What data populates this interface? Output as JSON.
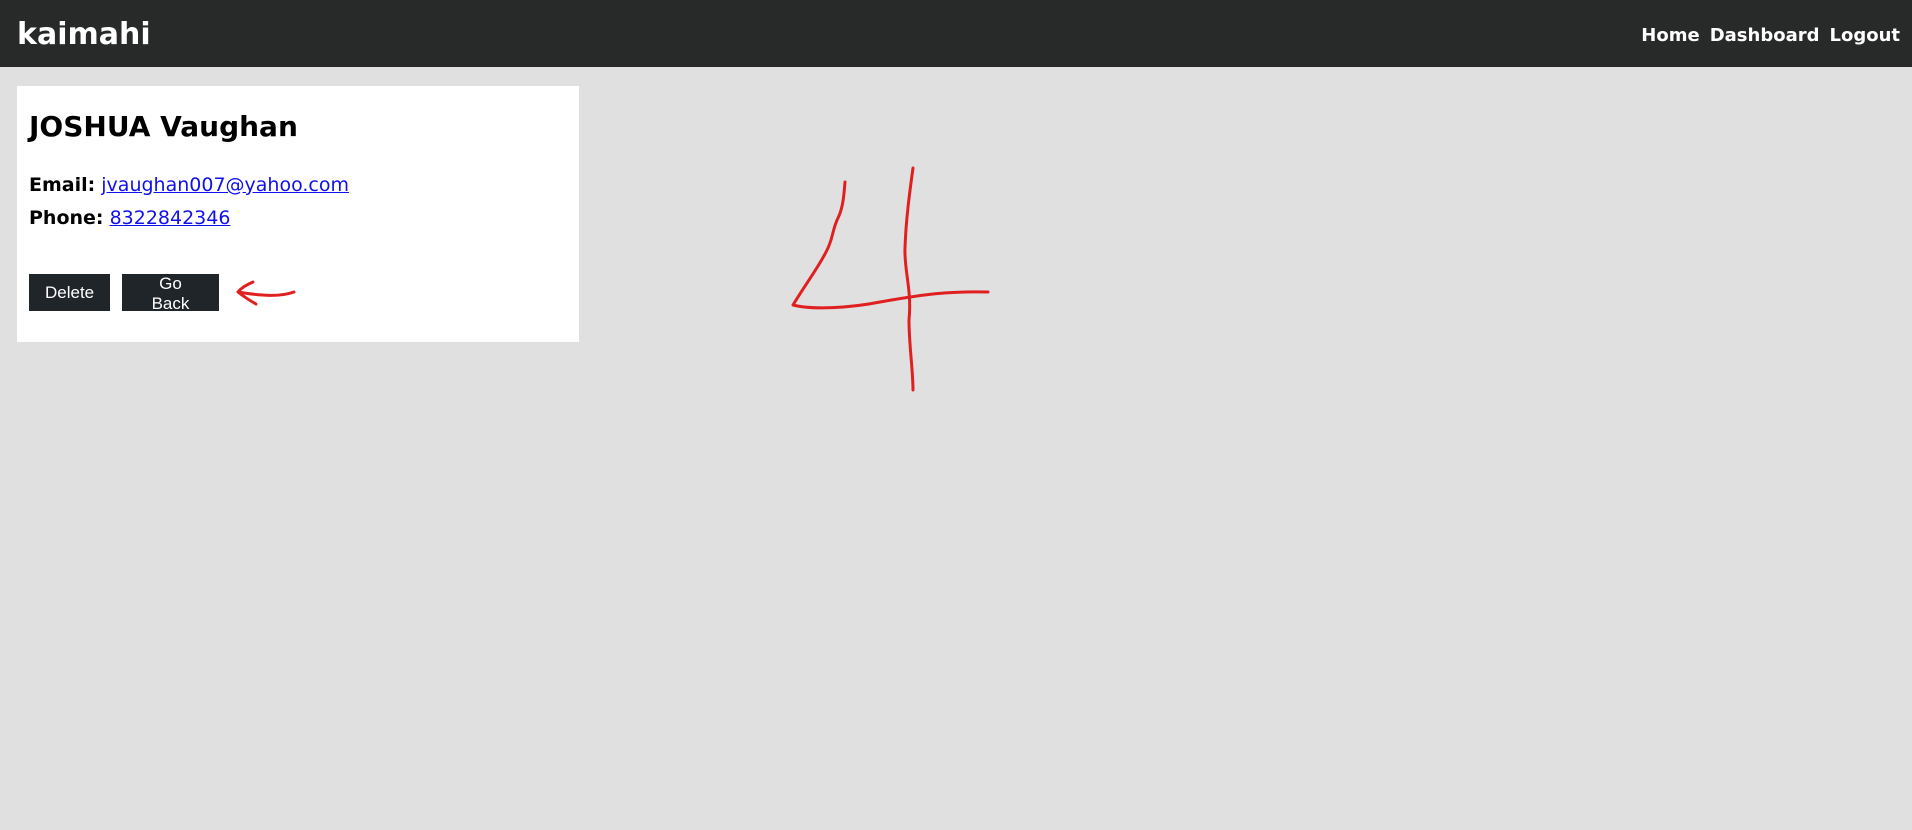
{
  "navbar": {
    "brand": "kaimahi",
    "links": [
      {
        "label": "Home"
      },
      {
        "label": "Dashboard"
      },
      {
        "label": "Logout"
      }
    ]
  },
  "contact": {
    "name": "JOSHUA Vaughan",
    "email_label": "Email:",
    "email": "jvaughan007@yahoo.com",
    "phone_label": "Phone:",
    "phone": "8322842346"
  },
  "actions": {
    "delete_label": "Delete",
    "back_label": "Go Back"
  },
  "annotations": {
    "color": "#e02020",
    "items": [
      "arrow-left-icon",
      "digit-four-drawing"
    ]
  }
}
